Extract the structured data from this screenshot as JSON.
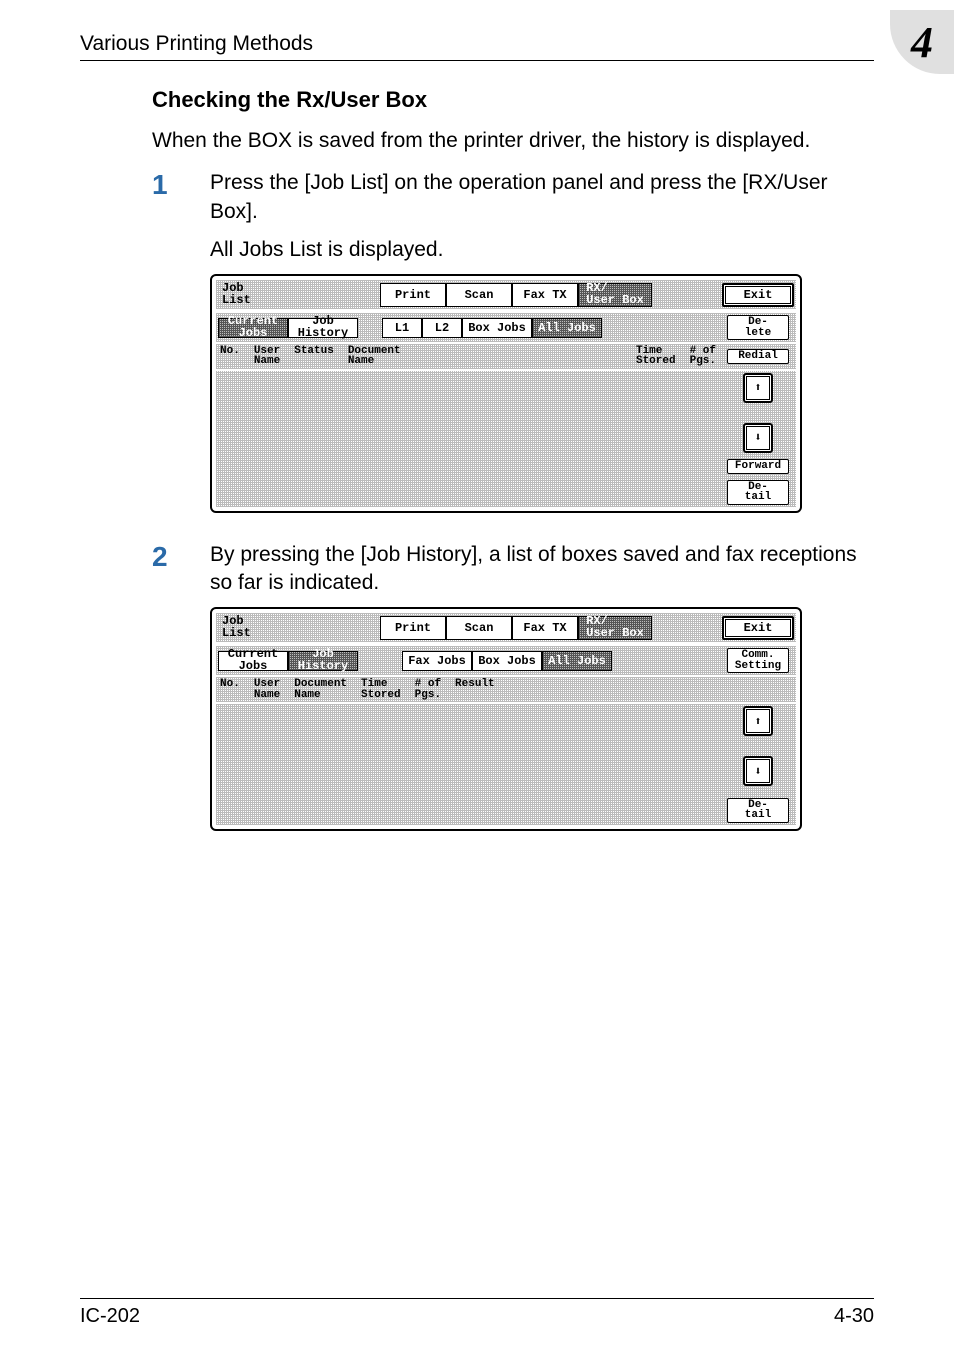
{
  "header": {
    "left": "Various Printing Methods",
    "right": "4"
  },
  "section_title": "Checking the Rx/User Box",
  "intro": "When the BOX is saved from the printer driver, the history is displayed.",
  "step1": {
    "num": "1",
    "text": "Press the [Job List] on the operation panel and press the [RX/User Box].",
    "subtext": "All Jobs List is displayed."
  },
  "step2": {
    "num": "2",
    "text": "By pressing the [Job History], a list of boxes saved and fax receptions so far is indicated."
  },
  "panel1": {
    "title": "Job\nList",
    "tabs": {
      "print": "Print",
      "scan": "Scan",
      "fax": "Fax TX",
      "rx": "RX/\nUser Box"
    },
    "exit": "Exit",
    "sub": {
      "current": "Current\nJobs",
      "history": "Job\nHistory",
      "l1": "L1",
      "l2": "L2",
      "box": "Box Jobs",
      "all": "All Jobs"
    },
    "delete": "De-\nlete",
    "cols": {
      "no": "No.",
      "user": "User\nName",
      "status": "Status",
      "doc": "Document\nName",
      "time": "Time\nStored",
      "pgs": "# of\nPgs."
    },
    "redial": "Redial",
    "forward": "Forward",
    "detail": "De-\ntail",
    "arrow_up": "⬆",
    "arrow_down": "⬇"
  },
  "panel2": {
    "title": "Job\nList",
    "tabs": {
      "print": "Print",
      "scan": "Scan",
      "fax": "Fax TX",
      "rx": "RX/\nUser Box"
    },
    "exit": "Exit",
    "sub": {
      "current": "Current\nJobs",
      "history": "Job\nHistory",
      "faxjobs": "Fax Jobs",
      "box": "Box Jobs",
      "all": "All Jobs"
    },
    "comm": "Comm.\nSetting",
    "cols": {
      "no": "No.",
      "user": "User\nName",
      "doc": "Document\nName",
      "time": "Time\nStored",
      "pgs": "# of\nPgs.",
      "result": "Result"
    },
    "detail": "De-\ntail",
    "arrow_up": "⬆",
    "arrow_down": "⬇"
  },
  "footer": {
    "left": "IC-202",
    "right": "4-30"
  }
}
